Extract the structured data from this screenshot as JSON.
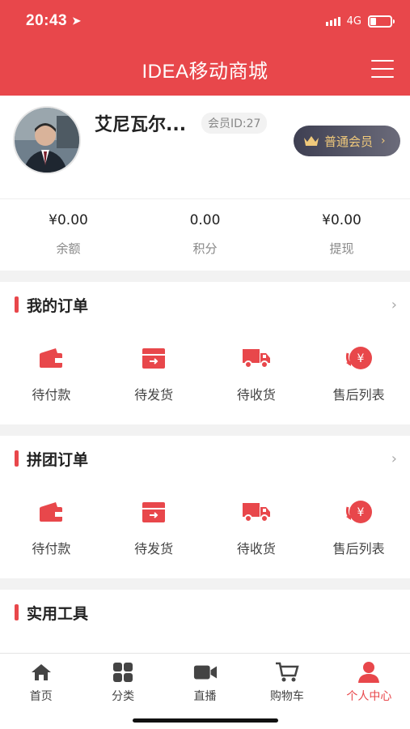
{
  "status": {
    "time": "20:43",
    "network": "4G",
    "battery_level": 0.3
  },
  "header": {
    "title": "IDEA移动商城"
  },
  "profile": {
    "name": "艾尼瓦尔...",
    "member_id": "会员ID:27",
    "level_label": "普通会员"
  },
  "balances": [
    {
      "value": "¥0.00",
      "label": "余额"
    },
    {
      "value": "0.00",
      "label": "积分"
    },
    {
      "value": "¥0.00",
      "label": "提现"
    }
  ],
  "orders": {
    "title": "我的订单",
    "items": [
      {
        "label": "待付款",
        "icon": "wallet-icon"
      },
      {
        "label": "待发货",
        "icon": "box-icon"
      },
      {
        "label": "待收货",
        "icon": "truck-icon"
      },
      {
        "label": "售后列表",
        "icon": "refund-icon"
      }
    ]
  },
  "group_orders": {
    "title": "拼团订单",
    "items": [
      {
        "label": "待付款",
        "icon": "wallet-icon"
      },
      {
        "label": "待发货",
        "icon": "box-icon"
      },
      {
        "label": "待收货",
        "icon": "truck-icon"
      },
      {
        "label": "售后列表",
        "icon": "refund-icon"
      }
    ]
  },
  "tools": {
    "title": "实用工具"
  },
  "tabbar": [
    {
      "label": "首页",
      "icon": "home-icon"
    },
    {
      "label": "分类",
      "icon": "grid-icon"
    },
    {
      "label": "直播",
      "icon": "video-icon"
    },
    {
      "label": "购物车",
      "icon": "cart-icon"
    },
    {
      "label": "个人中心",
      "icon": "user-icon",
      "active": true
    }
  ],
  "colors": {
    "accent": "#e8474b",
    "gold": "#f0c97b"
  }
}
